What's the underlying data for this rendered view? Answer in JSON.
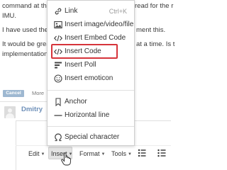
{
  "background": {
    "line1_left": "command at the",
    "line1_right": "read for the r",
    "line2_left": "IMU.",
    "line3_left": "I have used the",
    "line3_right": "ment this.",
    "line4_left": "It would be grea",
    "line4_right": "at a time. Is t",
    "line5_left": "implementation'",
    "cancel_label": "Cancel",
    "more_label": "More"
  },
  "post": {
    "username": "Dmitry"
  },
  "toolbar": {
    "edit_label": "Edit",
    "insert_label": "Insert",
    "format_label": "Format",
    "tools_label": "Tools",
    "list_icon": "bulleted-list-icon",
    "numbered_icon": "numbered-list-icon"
  },
  "insert_menu": {
    "items": [
      {
        "label": "Link",
        "shortcut": "Ctrl+K",
        "icon": "link-icon"
      },
      {
        "label": "Insert image/video/file",
        "icon": "image-icon"
      },
      {
        "label": "Insert Embed Code",
        "icon": "embed-code-icon"
      },
      {
        "label": "Insert Code",
        "icon": "code-icon",
        "highlighted": true
      },
      {
        "label": "Insert Poll",
        "icon": "poll-icon"
      },
      {
        "label": "Insert emoticon",
        "icon": "emoticon-icon"
      },
      {
        "label": "Anchor",
        "icon": "bookmark-icon"
      },
      {
        "label": "Horizontal line",
        "icon": "horizontal-line-icon"
      },
      {
        "label": "Special character",
        "icon": "omega-icon"
      }
    ]
  },
  "colors": {
    "highlight_border": "#d6343b",
    "username": "#6d8fb8",
    "cancel_button": "#9eb8d1"
  }
}
